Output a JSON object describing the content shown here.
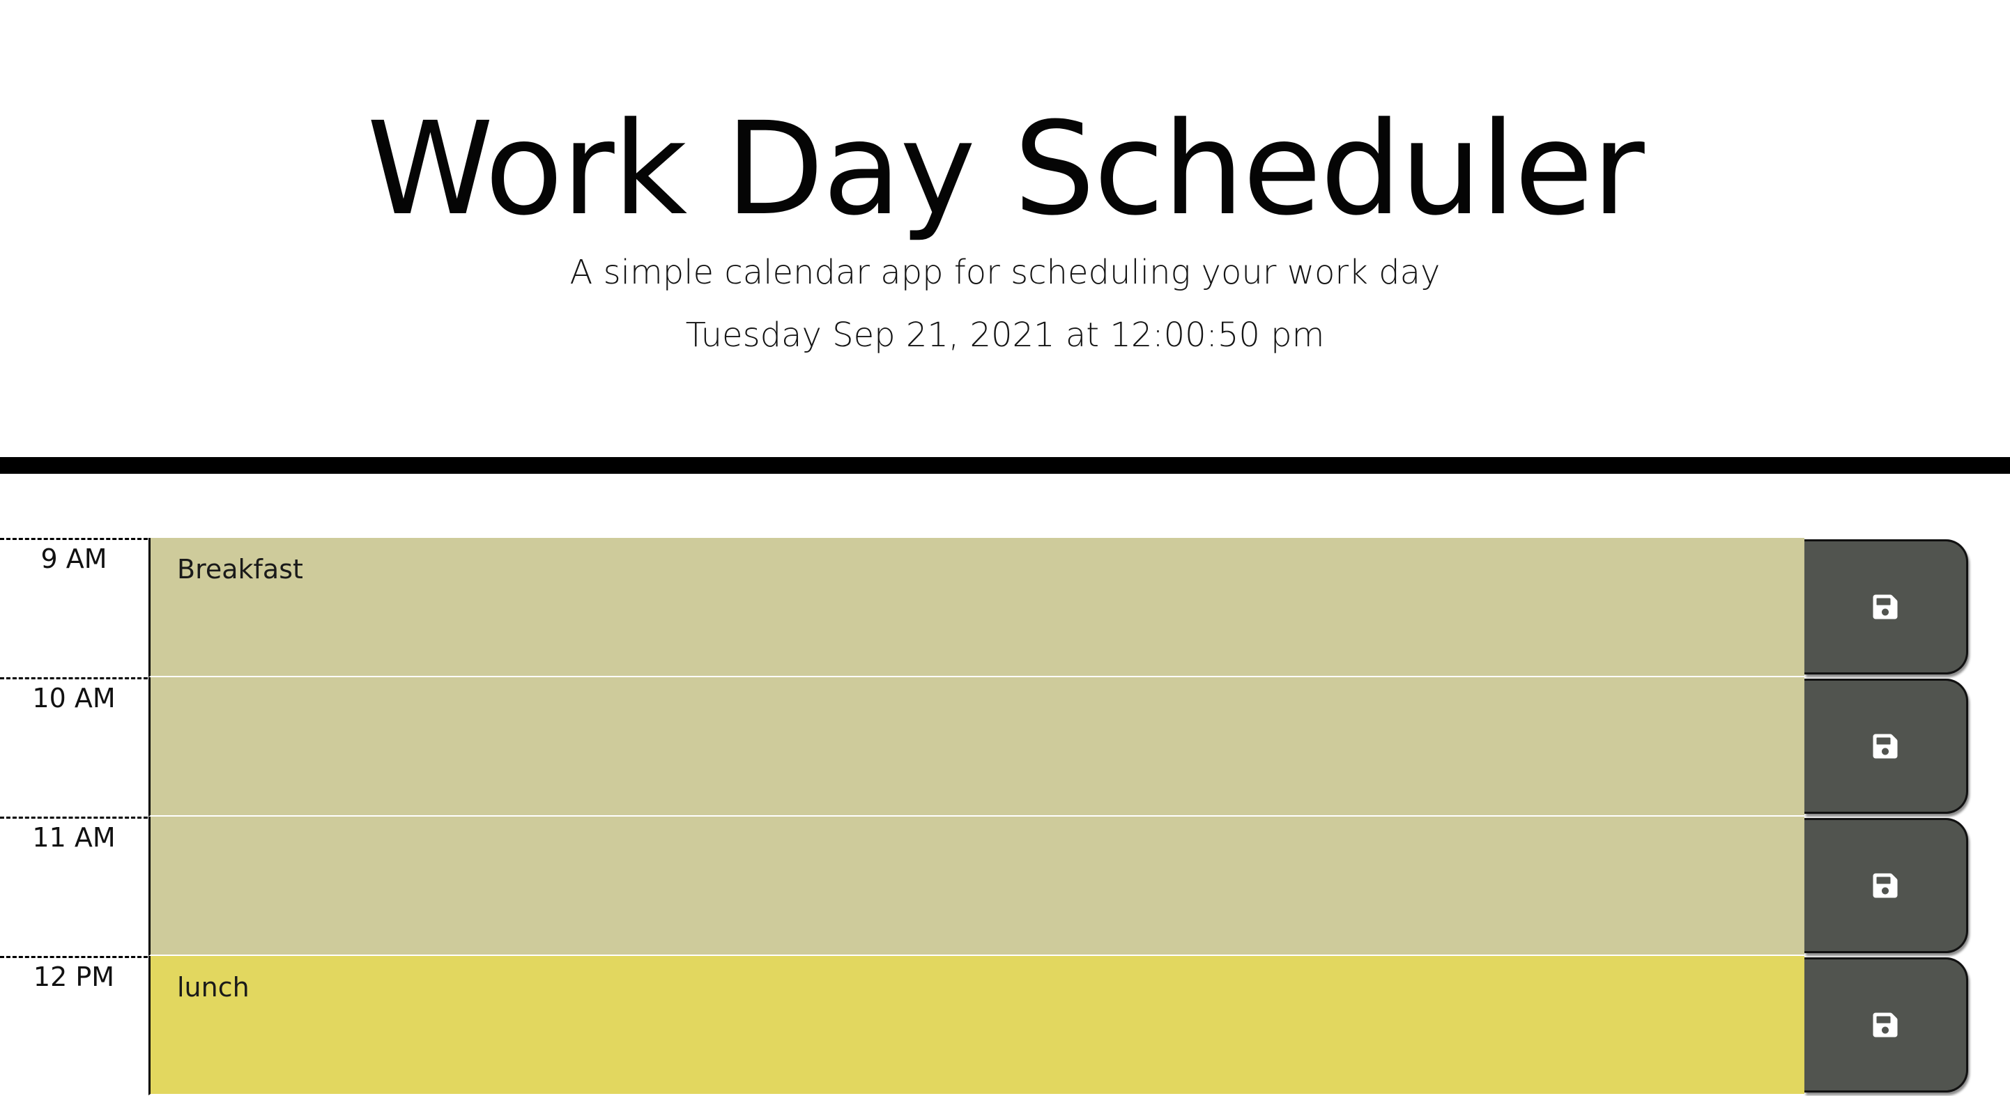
{
  "header": {
    "title": "Work Day Scheduler",
    "subtitle": "A simple calendar app for scheduling your work day",
    "current_datetime": "Tuesday Sep 21, 2021 at 12:00:50 pm"
  },
  "colors": {
    "past": "#cecb9b",
    "present": "#e2d75f",
    "save_button": "#51544f",
    "divider": "#000000"
  },
  "time_blocks": [
    {
      "hour": "9 AM",
      "text": "Breakfast",
      "status": "past",
      "icon": "floppy-disk-save-icon"
    },
    {
      "hour": "10 AM",
      "text": "",
      "status": "past",
      "icon": "floppy-disk-save-icon"
    },
    {
      "hour": "11 AM",
      "text": "",
      "status": "past",
      "icon": "floppy-disk-save-icon"
    },
    {
      "hour": "12 PM",
      "text": "lunch",
      "status": "present",
      "icon": "floppy-disk-save-icon"
    }
  ]
}
